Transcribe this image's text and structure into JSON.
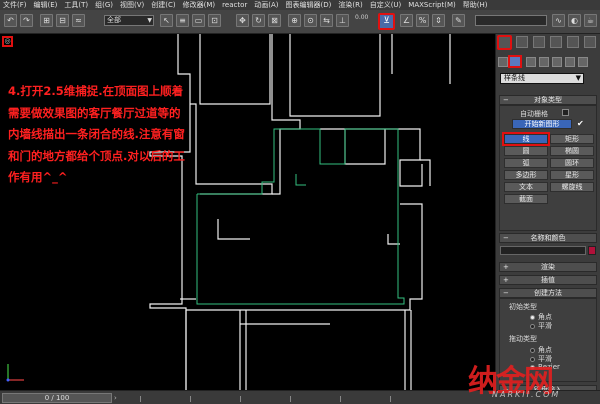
{
  "menu": [
    "文件(F)",
    "编辑(E)",
    "工具(T)",
    "组(G)",
    "视图(V)",
    "创建(C)",
    "修改器(M)",
    "reactor",
    "动画(A)",
    "图表编辑器(D)",
    "渲染(R)",
    "自定义(U)",
    "MAXScript(M)",
    "帮助(H)"
  ],
  "toolbar": {
    "selection_filter": "全部",
    "spinner_value": "0.00",
    "snap_toggle_label": "2.5"
  },
  "viewport": {
    "instruction_text": "4.打开2.5维捕捉.在顶面图上顺着需要做效果图的客厅餐厅过道等的内墙线描出一条闭合的线.注意有窗和门的地方都给个顶点.对以后的工作有用^_^"
  },
  "command_panel": {
    "category": "样条线",
    "object_type_title": "对象类型",
    "auto_grid": "自动栅格",
    "start_new_shape": "开始新图形",
    "object_buttons": [
      "线",
      "矩形",
      "圆",
      "椭圆",
      "弧",
      "圆环",
      "多边形",
      "星形",
      "文本",
      "螺旋线",
      "截面"
    ],
    "name_color_title": "名称和颜色",
    "rollouts": [
      "渲染",
      "插值",
      "创建方法"
    ],
    "initial_type_label": "初始类型",
    "drag_type_label": "拖动类型",
    "initial_options": [
      "角点",
      "平滑"
    ],
    "drag_options": [
      "角点",
      "平滑",
      "Bezier"
    ],
    "keyboard_entry": "键盘输入",
    "accent_color": "#3a66b8",
    "highlight_color": "#e01010"
  },
  "status": {
    "time_slider": "0 / 100"
  },
  "watermark": {
    "logo_text": "纳金网",
    "sub_text": "NARKII.COM"
  }
}
